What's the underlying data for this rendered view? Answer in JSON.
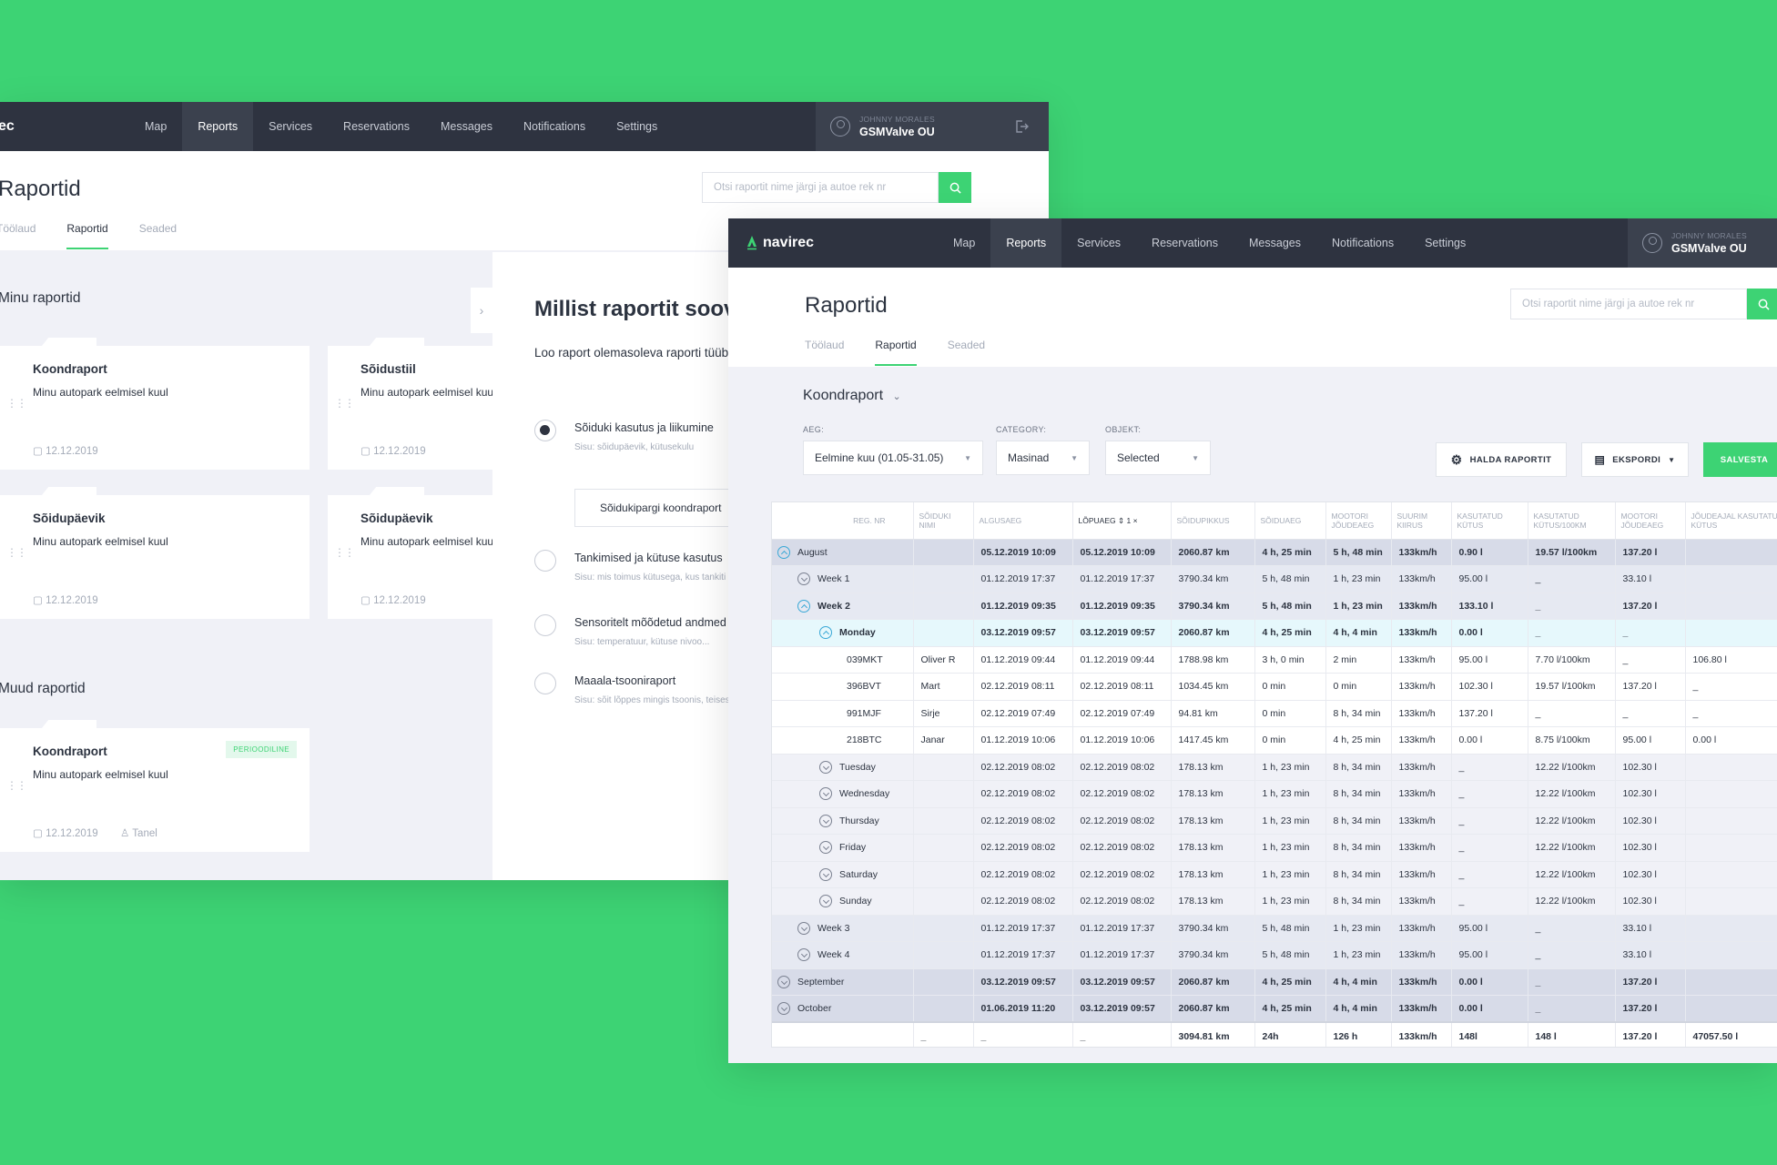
{
  "nav": [
    "Map",
    "Reports",
    "Services",
    "Reservations",
    "Messages",
    "Notifications",
    "Settings"
  ],
  "user": {
    "name": "JOHNNY MORALES",
    "company": "GSMValve OU"
  },
  "brand": {
    "back_partial": "ec",
    "front": "navirec"
  },
  "page": {
    "title": "Raportid",
    "tabs": [
      "Töölaud",
      "Raportid",
      "Seaded"
    ],
    "search_placeholder": "Otsi raportit nime järgi ja autoe rek nr"
  },
  "back": {
    "my_reports_title": "Minu raportid",
    "other_reports_title": "Muud raportid",
    "cards": [
      {
        "title": "Koondraport",
        "desc": "Minu autopark eelmisel kuul",
        "date": "12.12.2019"
      },
      {
        "title": "Sõidustiil",
        "desc": "Minu autopark eelmisel kuul",
        "date": "12.12.2019"
      },
      {
        "title": "Sõidupäevik",
        "desc": "Minu autopark eelmisel kuul",
        "date": "12.12.2019"
      },
      {
        "title": "Sõidupäevik",
        "desc": "Minu autopark eelmisel kuul",
        "date": "12.12.2019"
      }
    ],
    "other_card": {
      "title": "Koondraport",
      "desc": "Minu autopark eelmisel kuul",
      "date": "12.12.2019",
      "user": "Tanel",
      "badge": "PERIOODILINE"
    },
    "panel": {
      "title": "Millist raportit soovid",
      "desc": "Loo raport olemasoleva raporti tüübi alusel, et saada sinu õigeid autopargi andmeid.",
      "options": [
        {
          "label": "Sõiduki kasutus ja liikumine",
          "sub": "Sisu: sõidupäevik, kütusekulu",
          "checked": true
        },
        {
          "label": "Tankimised ja kütuse kasutus",
          "sub": "Sisu: mis toimus kütusega, kus tankiti",
          "checked": false
        },
        {
          "label": "Sensoritelt mõõdetud andmed",
          "sub": "Sisu: temperatuur, kütuse nivoo...",
          "checked": false
        },
        {
          "label": "Maaala-tsooniraport",
          "sub": "Sisu: sõit lõppes mingis tsoonis, teises",
          "checked": false
        }
      ],
      "sub_button": "Sõidukipargi koondraport"
    }
  },
  "front": {
    "report_name": "Koondraport",
    "filters": {
      "aeg_label": "AEG:",
      "aeg_value": "Eelmine kuu (01.05-31.05)",
      "category_label": "CATEGORY:",
      "category_value": "Masinad",
      "objekt_label": "OBJEKT:",
      "objekt_value": "Selected"
    },
    "buttons": {
      "manage": "HALDA RAPORTIT",
      "export": "EKSPORDI",
      "save": "SALVESTA"
    },
    "columns": [
      "REG. NR",
      "SÕIDUKI NIMI",
      "ALGUSAEG",
      "LÕPUAEG",
      "SÕIDUPIKKUS",
      "SÕIDUAEG",
      "MOOTORI JÕUDEAEG",
      "SUURIM KIIRUS",
      "KASUTATUD KÜTUS",
      "KASUTATUD KÜTUS/100KM",
      "MOOTORI JÕUDEAEG",
      "JÕUDEAJAL KASUTATUD KÜTUS"
    ],
    "sort_badge": "1 ×",
    "rows": [
      {
        "level": "lvl0",
        "toggle": "open",
        "cells": [
          "August",
          "",
          "05.12.2019 10:09",
          "05.12.2019 10:09",
          "2060.87 km",
          "4 h, 25 min",
          "5 h, 48 min",
          "133km/h",
          "0.90 l",
          "19.57 l/100km",
          "137.20 l",
          ""
        ]
      },
      {
        "level": "lvl1",
        "toggle": "closed",
        "cells": [
          "Week 1",
          "",
          "01.12.2019 17:37",
          "01.12.2019 17:37",
          "3790.34 km",
          "5 h, 48 min",
          "1 h, 23 min",
          "133km/h",
          "95.00 l",
          "_",
          "33.10 l",
          ""
        ]
      },
      {
        "level": "lvl1-open",
        "toggle": "open",
        "cells": [
          "Week 2",
          "",
          "01.12.2019 09:35",
          "01.12.2019 09:35",
          "3790.34 km",
          "5 h, 48 min",
          "1 h, 23 min",
          "133km/h",
          "133.10 l",
          "_",
          "137.20 l",
          ""
        ]
      },
      {
        "level": "lvl2-open",
        "toggle": "open",
        "cells": [
          "Monday",
          "",
          "03.12.2019 09:57",
          "03.12.2019 09:57",
          "2060.87 km",
          "4 h, 25 min",
          "4 h, 4 min",
          "133km/h",
          "0.00 l",
          "_",
          "_",
          ""
        ]
      },
      {
        "level": "veh",
        "toggle": "",
        "cells": [
          "039MKT",
          "Oliver R",
          "01.12.2019 09:44",
          "01.12.2019 09:44",
          "1788.98 km",
          "3 h, 0 min",
          "2 min",
          "133km/h",
          "95.00 l",
          "7.70 l/100km",
          "_",
          "106.80 l"
        ]
      },
      {
        "level": "veh",
        "toggle": "",
        "cells": [
          "396BVT",
          "Mart",
          "02.12.2019 08:11",
          "02.12.2019 08:11",
          "1034.45 km",
          "0 min",
          "0 min",
          "133km/h",
          "102.30 l",
          "19.57 l/100km",
          "137.20 l",
          "_"
        ]
      },
      {
        "level": "veh",
        "toggle": "",
        "cells": [
          "991MJF",
          "Sirje",
          "02.12.2019 07:49",
          "02.12.2019 07:49",
          "94.81 km",
          "0 min",
          "8 h, 34 min",
          "133km/h",
          "137.20 l",
          "_",
          "_",
          "_"
        ]
      },
      {
        "level": "veh",
        "toggle": "",
        "cells": [
          "218BTC",
          "Janar",
          "01.12.2019 10:06",
          "01.12.2019 10:06",
          "1417.45 km",
          "0 min",
          "4 h, 25 min",
          "133km/h",
          "0.00 l",
          "8.75 l/100km",
          "95.00 l",
          "0.00 l"
        ]
      },
      {
        "level": "lvl2",
        "toggle": "closed",
        "cells": [
          "Tuesday",
          "",
          "02.12.2019 08:02",
          "02.12.2019 08:02",
          "178.13 km",
          "1 h, 23 min",
          "8 h, 34 min",
          "133km/h",
          "_",
          "12.22 l/100km",
          "102.30 l",
          ""
        ]
      },
      {
        "level": "lvl2",
        "toggle": "closed",
        "cells": [
          "Wednesday",
          "",
          "02.12.2019 08:02",
          "02.12.2019 08:02",
          "178.13 km",
          "1 h, 23 min",
          "8 h, 34 min",
          "133km/h",
          "_",
          "12.22 l/100km",
          "102.30 l",
          ""
        ]
      },
      {
        "level": "lvl2",
        "toggle": "closed",
        "cells": [
          "Thursday",
          "",
          "02.12.2019 08:02",
          "02.12.2019 08:02",
          "178.13 km",
          "1 h, 23 min",
          "8 h, 34 min",
          "133km/h",
          "_",
          "12.22 l/100km",
          "102.30 l",
          ""
        ]
      },
      {
        "level": "lvl2",
        "toggle": "closed",
        "cells": [
          "Friday",
          "",
          "02.12.2019 08:02",
          "02.12.2019 08:02",
          "178.13 km",
          "1 h, 23 min",
          "8 h, 34 min",
          "133km/h",
          "_",
          "12.22 l/100km",
          "102.30 l",
          ""
        ]
      },
      {
        "level": "lvl2",
        "toggle": "closed",
        "cells": [
          "Saturday",
          "",
          "02.12.2019 08:02",
          "02.12.2019 08:02",
          "178.13 km",
          "1 h, 23 min",
          "8 h, 34 min",
          "133km/h",
          "_",
          "12.22 l/100km",
          "102.30 l",
          ""
        ]
      },
      {
        "level": "lvl2",
        "toggle": "closed",
        "cells": [
          "Sunday",
          "",
          "02.12.2019 08:02",
          "02.12.2019 08:02",
          "178.13 km",
          "1 h, 23 min",
          "8 h, 34 min",
          "133km/h",
          "_",
          "12.22 l/100km",
          "102.30 l",
          ""
        ]
      },
      {
        "level": "lvl1",
        "toggle": "closed",
        "cells": [
          "Week 3",
          "",
          "01.12.2019 17:37",
          "01.12.2019 17:37",
          "3790.34 km",
          "5 h, 48 min",
          "1 h, 23 min",
          "133km/h",
          "95.00 l",
          "_",
          "33.10 l",
          ""
        ]
      },
      {
        "level": "lvl1",
        "toggle": "closed",
        "cells": [
          "Week 4",
          "",
          "01.12.2019 17:37",
          "01.12.2019 17:37",
          "3790.34 km",
          "5 h, 48 min",
          "1 h, 23 min",
          "133km/h",
          "95.00 l",
          "_",
          "33.10 l",
          ""
        ]
      },
      {
        "level": "lvl0",
        "toggle": "closed",
        "cells": [
          "September",
          "",
          "03.12.2019 09:57",
          "03.12.2019 09:57",
          "2060.87 km",
          "4 h, 25 min",
          "4 h, 4 min",
          "133km/h",
          "0.00 l",
          "_",
          "137.20 l",
          ""
        ]
      },
      {
        "level": "lvl0",
        "toggle": "closed",
        "cells": [
          "October",
          "",
          "01.06.2019 11:20",
          "03.12.2019 09:57",
          "2060.87 km",
          "4 h, 25 min",
          "4 h, 4 min",
          "133km/h",
          "0.00 l",
          "_",
          "137.20 l",
          ""
        ]
      },
      {
        "level": "sum",
        "toggle": "",
        "cells": [
          "",
          "_",
          "_",
          "_",
          "3094.81 km",
          "24h",
          "126 h",
          "133km/h",
          "148l",
          "148 l",
          "137.20 l",
          "47057.50 l"
        ]
      }
    ]
  },
  "colors": {
    "bg": "#3dd374",
    "topbar": "#2e3340",
    "accent": "#3dd374",
    "highlight": "#39a8d6"
  }
}
